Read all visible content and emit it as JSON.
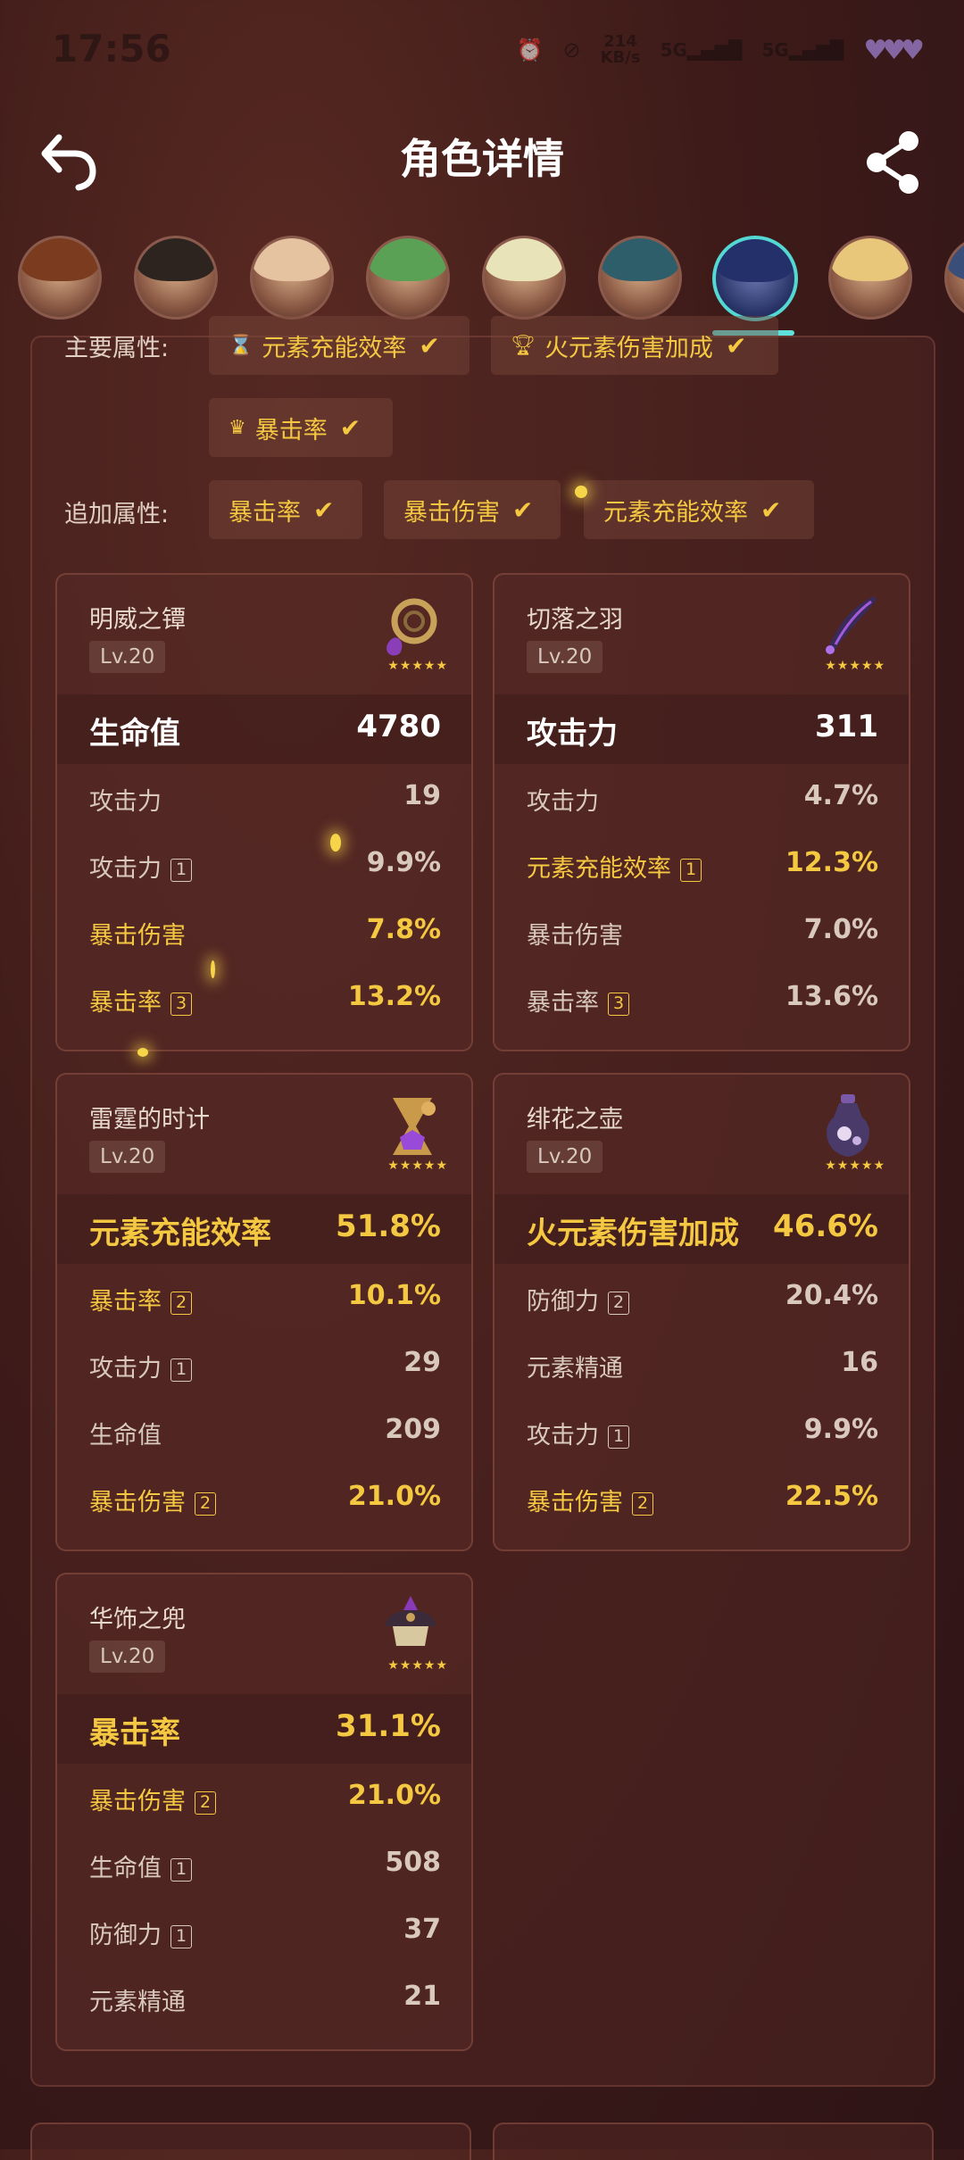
{
  "status": {
    "time": "17:56",
    "net_speed_value": "214",
    "net_speed_unit": "KB/s",
    "signal1": "5G",
    "signal2": "5G"
  },
  "header": {
    "title": "角色详情"
  },
  "attributes": {
    "main_label": "主要属性:",
    "main_tags": [
      "元素充能效率",
      "火元素伤害加成",
      "暴击率"
    ],
    "extra_label": "追加属性:",
    "extra_tags": [
      "暴击率",
      "暴击伤害",
      "元素充能效率"
    ]
  },
  "cards": [
    {
      "name": "明威之镡",
      "level": "Lv.20",
      "main_stat": {
        "label": "生命值",
        "value": "4780"
      },
      "substats": [
        {
          "label": "攻击力",
          "badge": "",
          "value": "19"
        },
        {
          "label": "攻击力",
          "badge": "1",
          "value": "9.9%"
        },
        {
          "label": "暴击伤害",
          "badge": "",
          "value": "7.8%"
        },
        {
          "label": "暴击率",
          "badge": "3",
          "value": "13.2%"
        }
      ]
    },
    {
      "name": "切落之羽",
      "level": "Lv.20",
      "main_stat": {
        "label": "攻击力",
        "value": "311"
      },
      "substats": [
        {
          "label": "攻击力",
          "badge": "",
          "value": "4.7%"
        },
        {
          "label": "元素充能效率",
          "badge": "1",
          "value": "12.3%"
        },
        {
          "label": "暴击伤害",
          "badge": "",
          "value": "7.0%"
        },
        {
          "label": "暴击率",
          "badge": "3",
          "value": "13.6%"
        }
      ]
    },
    {
      "name": "雷霆的时计",
      "level": "Lv.20",
      "main_stat": {
        "label": "元素充能效率",
        "value": "51.8%"
      },
      "substats": [
        {
          "label": "暴击率",
          "badge": "2",
          "value": "10.1%"
        },
        {
          "label": "攻击力",
          "badge": "1",
          "value": "29"
        },
        {
          "label": "生命值",
          "badge": "",
          "value": "209"
        },
        {
          "label": "暴击伤害",
          "badge": "2",
          "value": "21.0%"
        }
      ]
    },
    {
      "name": "绯花之壶",
      "level": "Lv.20",
      "main_stat": {
        "label": "火元素伤害加成",
        "value": "46.6%"
      },
      "substats": [
        {
          "label": "防御力",
          "badge": "2",
          "value": "20.4%"
        },
        {
          "label": "元素精通",
          "badge": "",
          "value": "16"
        },
        {
          "label": "攻击力",
          "badge": "1",
          "value": "9.9%"
        },
        {
          "label": "暴击伤害",
          "badge": "2",
          "value": "22.5%"
        }
      ]
    },
    {
      "name": "华饰之兜",
      "level": "Lv.20",
      "main_stat": {
        "label": "暴击率",
        "value": "31.1%"
      },
      "substats": [
        {
          "label": "暴击伤害",
          "badge": "2",
          "value": "21.0%"
        },
        {
          "label": "生命值",
          "badge": "1",
          "value": "508"
        },
        {
          "label": "防御力",
          "badge": "1",
          "value": "37"
        },
        {
          "label": "元素精通",
          "badge": "",
          "value": "21"
        }
      ]
    }
  ],
  "colors": {
    "gold": "#f5c842",
    "active_avatar": "#54d8d3"
  },
  "icons": {
    "back": "back-arrow-icon",
    "share": "share-icon",
    "check": "check-icon"
  }
}
